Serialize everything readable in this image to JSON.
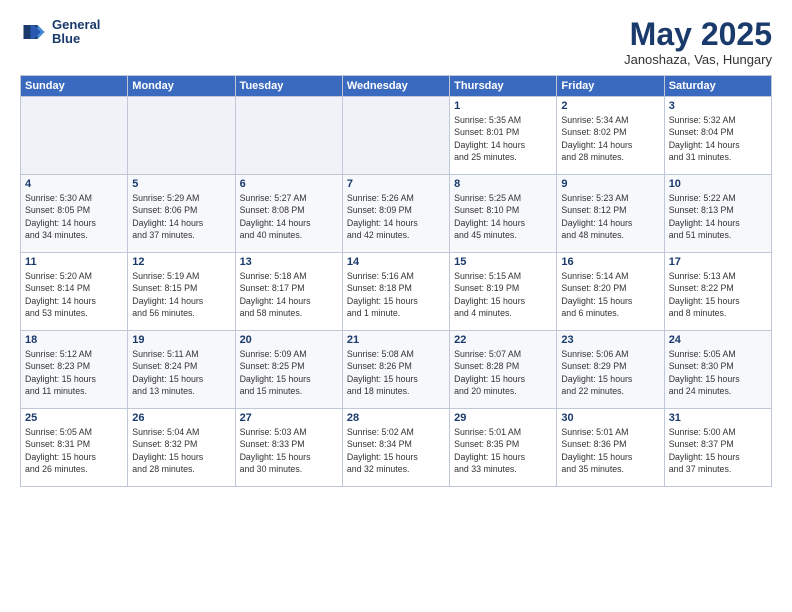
{
  "header": {
    "logo_line1": "General",
    "logo_line2": "Blue",
    "title": "May 2025",
    "subtitle": "Janoshaza, Vas, Hungary"
  },
  "weekdays": [
    "Sunday",
    "Monday",
    "Tuesday",
    "Wednesday",
    "Thursday",
    "Friday",
    "Saturday"
  ],
  "weeks": [
    [
      {
        "num": "",
        "info": ""
      },
      {
        "num": "",
        "info": ""
      },
      {
        "num": "",
        "info": ""
      },
      {
        "num": "",
        "info": ""
      },
      {
        "num": "1",
        "info": "Sunrise: 5:35 AM\nSunset: 8:01 PM\nDaylight: 14 hours\nand 25 minutes."
      },
      {
        "num": "2",
        "info": "Sunrise: 5:34 AM\nSunset: 8:02 PM\nDaylight: 14 hours\nand 28 minutes."
      },
      {
        "num": "3",
        "info": "Sunrise: 5:32 AM\nSunset: 8:04 PM\nDaylight: 14 hours\nand 31 minutes."
      }
    ],
    [
      {
        "num": "4",
        "info": "Sunrise: 5:30 AM\nSunset: 8:05 PM\nDaylight: 14 hours\nand 34 minutes."
      },
      {
        "num": "5",
        "info": "Sunrise: 5:29 AM\nSunset: 8:06 PM\nDaylight: 14 hours\nand 37 minutes."
      },
      {
        "num": "6",
        "info": "Sunrise: 5:27 AM\nSunset: 8:08 PM\nDaylight: 14 hours\nand 40 minutes."
      },
      {
        "num": "7",
        "info": "Sunrise: 5:26 AM\nSunset: 8:09 PM\nDaylight: 14 hours\nand 42 minutes."
      },
      {
        "num": "8",
        "info": "Sunrise: 5:25 AM\nSunset: 8:10 PM\nDaylight: 14 hours\nand 45 minutes."
      },
      {
        "num": "9",
        "info": "Sunrise: 5:23 AM\nSunset: 8:12 PM\nDaylight: 14 hours\nand 48 minutes."
      },
      {
        "num": "10",
        "info": "Sunrise: 5:22 AM\nSunset: 8:13 PM\nDaylight: 14 hours\nand 51 minutes."
      }
    ],
    [
      {
        "num": "11",
        "info": "Sunrise: 5:20 AM\nSunset: 8:14 PM\nDaylight: 14 hours\nand 53 minutes."
      },
      {
        "num": "12",
        "info": "Sunrise: 5:19 AM\nSunset: 8:15 PM\nDaylight: 14 hours\nand 56 minutes."
      },
      {
        "num": "13",
        "info": "Sunrise: 5:18 AM\nSunset: 8:17 PM\nDaylight: 14 hours\nand 58 minutes."
      },
      {
        "num": "14",
        "info": "Sunrise: 5:16 AM\nSunset: 8:18 PM\nDaylight: 15 hours\nand 1 minute."
      },
      {
        "num": "15",
        "info": "Sunrise: 5:15 AM\nSunset: 8:19 PM\nDaylight: 15 hours\nand 4 minutes."
      },
      {
        "num": "16",
        "info": "Sunrise: 5:14 AM\nSunset: 8:20 PM\nDaylight: 15 hours\nand 6 minutes."
      },
      {
        "num": "17",
        "info": "Sunrise: 5:13 AM\nSunset: 8:22 PM\nDaylight: 15 hours\nand 8 minutes."
      }
    ],
    [
      {
        "num": "18",
        "info": "Sunrise: 5:12 AM\nSunset: 8:23 PM\nDaylight: 15 hours\nand 11 minutes."
      },
      {
        "num": "19",
        "info": "Sunrise: 5:11 AM\nSunset: 8:24 PM\nDaylight: 15 hours\nand 13 minutes."
      },
      {
        "num": "20",
        "info": "Sunrise: 5:09 AM\nSunset: 8:25 PM\nDaylight: 15 hours\nand 15 minutes."
      },
      {
        "num": "21",
        "info": "Sunrise: 5:08 AM\nSunset: 8:26 PM\nDaylight: 15 hours\nand 18 minutes."
      },
      {
        "num": "22",
        "info": "Sunrise: 5:07 AM\nSunset: 8:28 PM\nDaylight: 15 hours\nand 20 minutes."
      },
      {
        "num": "23",
        "info": "Sunrise: 5:06 AM\nSunset: 8:29 PM\nDaylight: 15 hours\nand 22 minutes."
      },
      {
        "num": "24",
        "info": "Sunrise: 5:05 AM\nSunset: 8:30 PM\nDaylight: 15 hours\nand 24 minutes."
      }
    ],
    [
      {
        "num": "25",
        "info": "Sunrise: 5:05 AM\nSunset: 8:31 PM\nDaylight: 15 hours\nand 26 minutes."
      },
      {
        "num": "26",
        "info": "Sunrise: 5:04 AM\nSunset: 8:32 PM\nDaylight: 15 hours\nand 28 minutes."
      },
      {
        "num": "27",
        "info": "Sunrise: 5:03 AM\nSunset: 8:33 PM\nDaylight: 15 hours\nand 30 minutes."
      },
      {
        "num": "28",
        "info": "Sunrise: 5:02 AM\nSunset: 8:34 PM\nDaylight: 15 hours\nand 32 minutes."
      },
      {
        "num": "29",
        "info": "Sunrise: 5:01 AM\nSunset: 8:35 PM\nDaylight: 15 hours\nand 33 minutes."
      },
      {
        "num": "30",
        "info": "Sunrise: 5:01 AM\nSunset: 8:36 PM\nDaylight: 15 hours\nand 35 minutes."
      },
      {
        "num": "31",
        "info": "Sunrise: 5:00 AM\nSunset: 8:37 PM\nDaylight: 15 hours\nand 37 minutes."
      }
    ]
  ]
}
